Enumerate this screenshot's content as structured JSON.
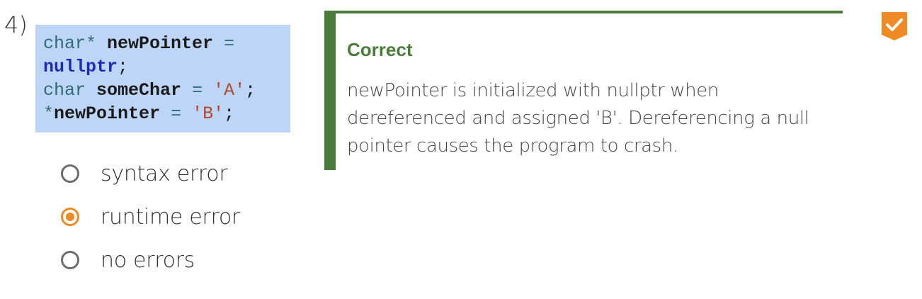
{
  "question": {
    "number": "4)",
    "code": {
      "line1": {
        "type": "char*",
        "ident": "newPointer",
        "op": "="
      },
      "line2": {
        "kw": "nullptr",
        "punc": ";"
      },
      "line3": {
        "type": "char",
        "ident": "someChar",
        "op": "=",
        "str": "'A'",
        "punc": ";"
      },
      "line4": {
        "op": "*",
        "ident": "newPointer",
        "op2": "=",
        "str": "'B'",
        "punc": ";"
      }
    },
    "options": [
      {
        "label": "syntax error",
        "selected": false
      },
      {
        "label": "runtime error",
        "selected": true
      },
      {
        "label": "no errors",
        "selected": false
      }
    ]
  },
  "feedback": {
    "title": "Correct",
    "text": "newPointer is initialized with nullptr when dereferenced and assigned 'B'. Dereferencing a null pointer causes the program to crash."
  },
  "colors": {
    "accent": "#f08a24",
    "correct": "#4a7d3c",
    "code_bg": "#bdd6f8"
  },
  "icons": {
    "status": "check-badge-icon"
  }
}
